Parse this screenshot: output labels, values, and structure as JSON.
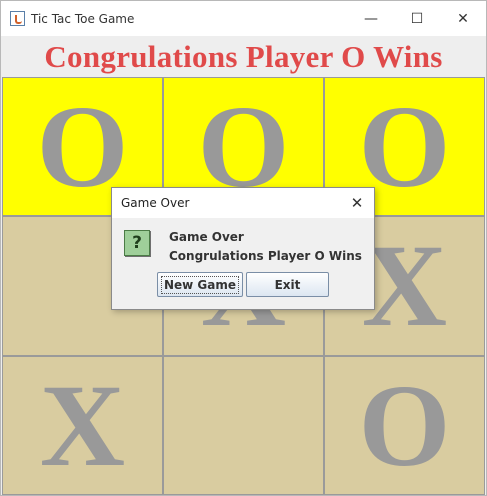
{
  "window": {
    "title": "Tic Tac Toe Game",
    "controls": {
      "minimize": "—",
      "maximize": "☐",
      "close": "✕"
    }
  },
  "banner": {
    "text": "Congrulations Player O Wins",
    "color": "#e04a4a"
  },
  "board": {
    "cells": [
      "O",
      "O",
      "O",
      "",
      "X",
      "X",
      "X",
      "",
      "O"
    ],
    "winning_cells": [
      0,
      1,
      2
    ],
    "colors": {
      "win": "#ffff00",
      "normal": "#d9cca0",
      "mark": "#999999"
    }
  },
  "dialog": {
    "title": "Game Over",
    "close": "✕",
    "icon": "question-icon",
    "icon_glyph": "?",
    "message_line1": "Game Over",
    "message_line2": "Congrulations Player O Wins",
    "new_game_label": "New Game",
    "exit_label": "Exit"
  }
}
